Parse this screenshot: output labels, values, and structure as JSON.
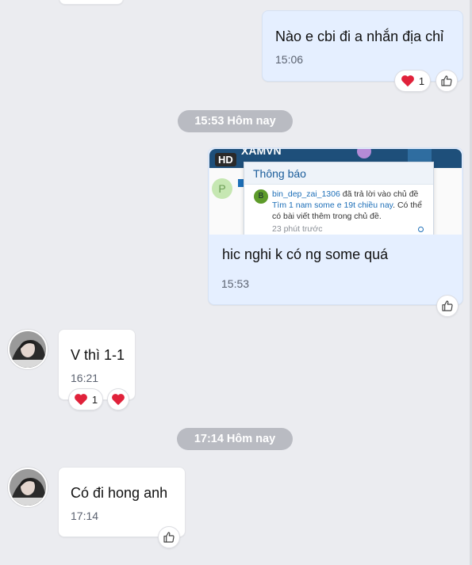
{
  "messages": {
    "m1": {
      "text": "Nào e cbi đi a nhắn địa chỉ",
      "time": "15:06",
      "reaction_count": "1"
    },
    "sep1": "15:53 Hôm nay",
    "m2": {
      "badge": "HD",
      "preview": {
        "header_text": "XAMVN",
        "notif_title": "Thông báo",
        "user": "bin_dep_zai_1306",
        "reply_text": " đã trả lời vào chủ đề ",
        "topic": "Tìm 1 nam some e 19t chiều nay",
        "tail": ". Có thể có bài viết thêm trong chủ đề.",
        "ago": "23 phút trước",
        "left_avatar_letter": "P",
        "notif_avatar_letter": "B"
      },
      "text": "hic nghi k có ng some quá",
      "time": "15:53"
    },
    "m3": {
      "text": "V thì 1-1",
      "time": "16:21",
      "reaction_count": "1"
    },
    "sep2": "17:14 Hôm nay",
    "m4": {
      "text": "Có đi hong anh",
      "time": "17:14"
    }
  },
  "icons": {
    "reaction": "heart-icon",
    "react_button": "thumbs-up-icon"
  },
  "colors": {
    "outgoing_bubble": "#e5efff",
    "incoming_bubble": "#ffffff",
    "heart": "#e0213a",
    "separator": "#b9bbc2",
    "background": "#ebecf0"
  }
}
